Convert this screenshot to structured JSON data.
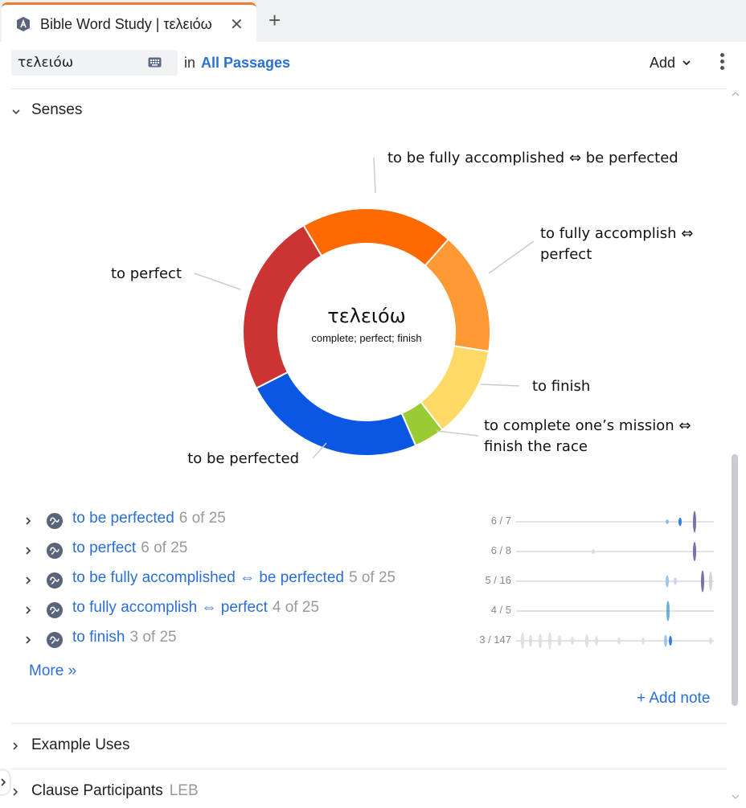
{
  "tab": {
    "title": "Bible Word Study | τελειόω"
  },
  "toolbar": {
    "search_value": "τελειόω",
    "in_label": "in",
    "passages_link": "All Passages",
    "add_label": "Add"
  },
  "senses_section": {
    "title": "Senses"
  },
  "chart_data": {
    "type": "pie",
    "center_title": "τελειόω",
    "center_subtitle": "complete; perfect; finish",
    "slices": [
      {
        "label_lines": [
          "to be fully accomplished ⇔ be perfected"
        ],
        "value": 5,
        "color": "#ff6a00"
      },
      {
        "label_lines": [
          "to fully accomplish ⇔",
          "perfect"
        ],
        "value": 4,
        "color": "#ff9933"
      },
      {
        "label_lines": [
          "to finish"
        ],
        "value": 3,
        "color": "#ffd966"
      },
      {
        "label_lines": [
          "to complete one’s mission ⇔",
          "finish the race"
        ],
        "value": 1,
        "color": "#99cc33"
      },
      {
        "label_lines": [
          "to be perfected"
        ],
        "value": 6,
        "color": "#0b57e3"
      },
      {
        "label_lines": [
          "to perfect"
        ],
        "value": 6,
        "color": "#cc3333"
      }
    ]
  },
  "senses": [
    {
      "label": "to be perfected",
      "count": "6 of 25",
      "ratio": "6 / 7"
    },
    {
      "label": "to perfect",
      "count": "6 of 25",
      "ratio": "6 / 8"
    },
    {
      "label": "to be fully accomplished ⇔ be perfected",
      "count": "5 of 25",
      "ratio": "5 / 16"
    },
    {
      "label": "to fully accomplish ⇔ perfect",
      "count": "4 of 25",
      "ratio": "4 / 5"
    },
    {
      "label": "to finish",
      "count": "3 of 25",
      "ratio": "3 / 147"
    }
  ],
  "more_link": "More »",
  "add_note": "+ Add note",
  "example_uses": {
    "title": "Example Uses"
  },
  "clause_participants": {
    "title": "Clause Participants",
    "version": "LEB"
  }
}
